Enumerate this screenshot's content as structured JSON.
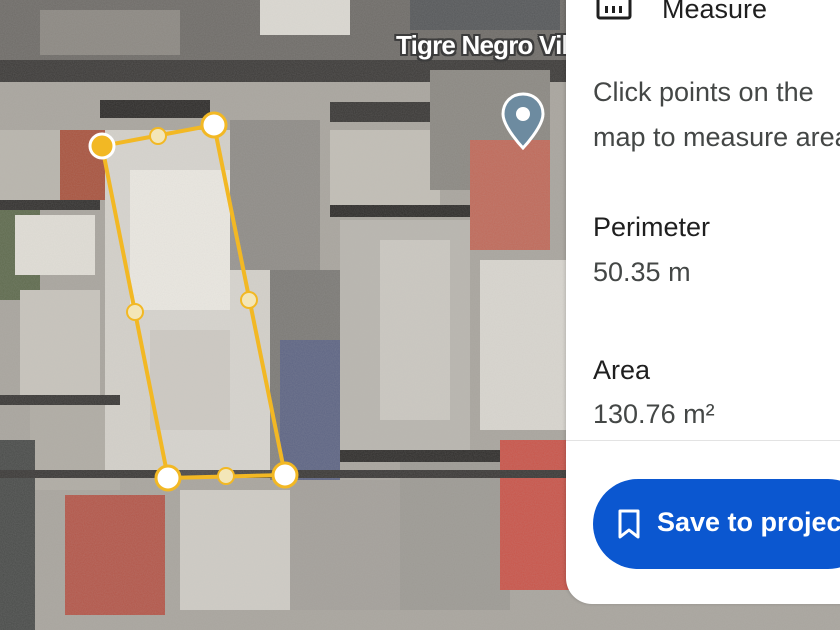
{
  "map": {
    "place_label": "Tigre Negro Vil",
    "pin": "place-pin-icon"
  },
  "measure_shape": {
    "vertices": "polygon-vertex-handle",
    "midpoints": "polygon-midpoint-handle",
    "color": "#f2b824"
  },
  "panel": {
    "title": "Measure",
    "title_icon": "ruler-icon",
    "hint": "Click points on the map to measure area",
    "perimeter_label": "Perimeter",
    "perimeter_value": "50.35 m",
    "area_label": "Area",
    "area_value": "130.76 m²",
    "save_button_label": "Save to project",
    "save_button_icon": "bookmark-icon",
    "accent": "#0b57d0"
  }
}
